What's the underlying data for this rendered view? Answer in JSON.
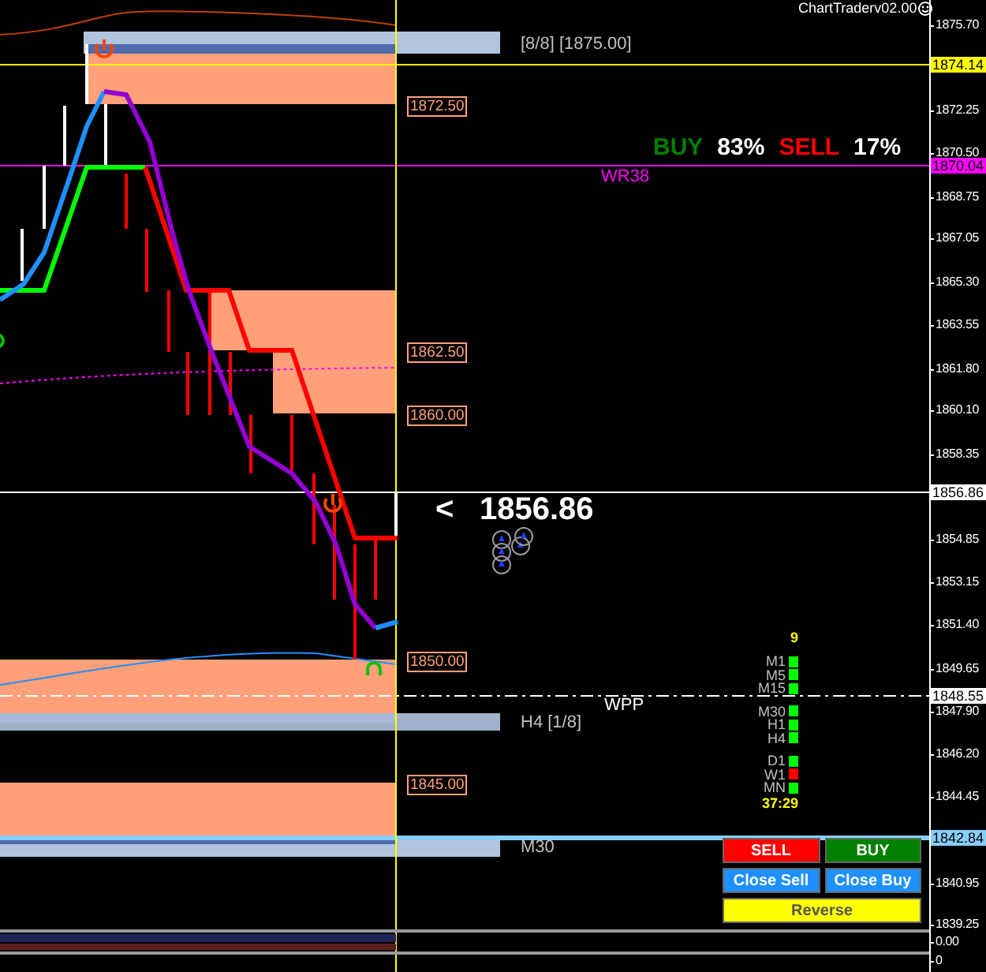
{
  "chart": {
    "title": "ChartTraderv02.00",
    "sentiment": {
      "buy_label": "BUY",
      "buy_value": "83%",
      "sell_label": "SELL",
      "sell_value": "17%"
    },
    "level_labels": [
      {
        "text": "[8/8] [1875.00]",
        "color": "#c0c0c0"
      },
      {
        "text": "WR38",
        "color": "#ff00ff"
      },
      {
        "text": "WPP",
        "color": "#ffffff"
      },
      {
        "text": "H4 [1/8]",
        "color": "#c0c0c0"
      },
      {
        "text": "M30",
        "color": "#c0c0c0"
      }
    ],
    "zone_labels": [
      "1872.50",
      "1862.50",
      "1860.00",
      "1850.00",
      "1845.00"
    ],
    "current_price": {
      "arrow": "<",
      "value": "1856.86"
    },
    "timeframes": {
      "count": "9",
      "groups": [
        {
          "items": [
            {
              "label": "M1",
              "color": "#00ff00"
            },
            {
              "label": "M5",
              "color": "#00ff00"
            },
            {
              "label": "M15",
              "color": "#00ff00"
            }
          ]
        },
        {
          "items": [
            {
              "label": "M30",
              "color": "#00ff00"
            },
            {
              "label": "H1",
              "color": "#00ff00"
            },
            {
              "label": "H4",
              "color": "#00ff00"
            }
          ]
        },
        {
          "items": [
            {
              "label": "D1",
              "color": "#00ff00"
            },
            {
              "label": "W1",
              "color": "#ff0000"
            },
            {
              "label": "MN",
              "color": "#00ff00"
            }
          ]
        }
      ],
      "timer": "37:29"
    },
    "buttons": [
      {
        "label": "SELL",
        "kind": "sell"
      },
      {
        "label": "BUY",
        "kind": "buy"
      },
      {
        "label": "Close Sell",
        "kind": "close"
      },
      {
        "label": "Close Buy",
        "kind": "close"
      },
      {
        "label": "Reverse",
        "kind": "reverse"
      }
    ]
  },
  "price_axis": {
    "ticks": [
      "1875.70",
      "1872.25",
      "1870.50",
      "1868.75",
      "1867.05",
      "1865.30",
      "1863.55",
      "1861.80",
      "1860.10",
      "1858.35",
      "1854.85",
      "1853.15",
      "1851.40",
      "1849.65",
      "1847.90",
      "1846.20",
      "1844.45",
      "1840.95",
      "1839.25"
    ],
    "markers": [
      {
        "text": "1874.14",
        "color": "#ffff00"
      },
      {
        "text": "1870.04",
        "color": "#ff00ff"
      },
      {
        "text": "1856.86",
        "color": "#ffffff"
      },
      {
        "text": "1848.55",
        "color": "#ffffff"
      },
      {
        "text": "1842.84",
        "color": "#87cefa"
      }
    ]
  },
  "subwindow_axis": [
    "0.00",
    "0"
  ]
}
